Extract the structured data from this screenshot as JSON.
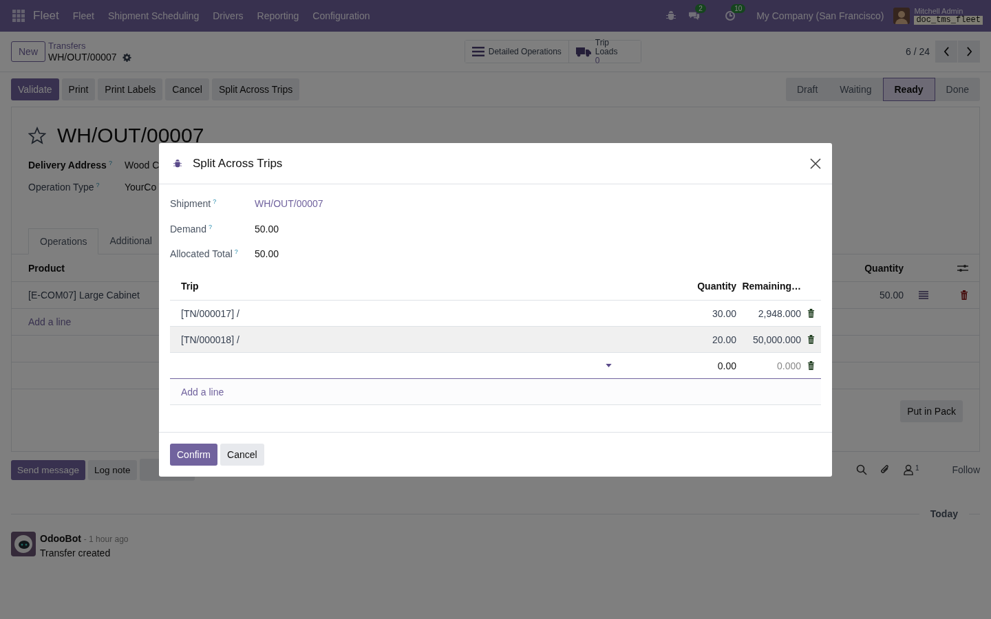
{
  "navbar": {
    "app_name": "Fleet",
    "menu": [
      "Fleet",
      "Shipment Scheduling",
      "Drivers",
      "Reporting",
      "Configuration"
    ],
    "messages_count": "2",
    "activities_count": "10",
    "company": "My Company (San Francisco)",
    "user_name": "Mitchell Admin",
    "database": "doc_tms_fleet"
  },
  "control_panel": {
    "new_button": "New",
    "breadcrumb": "Transfers",
    "record": "WH/OUT/00007",
    "smart_buttons": [
      {
        "kind": "list",
        "label": "Detailed Operations"
      },
      {
        "kind": "truck",
        "label": "Trip Loads",
        "value": "0"
      }
    ],
    "pager": "6 / 24"
  },
  "action_buttons": [
    {
      "label": "Validate",
      "primary": true
    },
    {
      "label": "Print",
      "primary": false
    },
    {
      "label": "Print Labels",
      "primary": false
    },
    {
      "label": "Cancel",
      "primary": false
    },
    {
      "label": "Split Across Trips",
      "primary": false
    }
  ],
  "statusbar": [
    {
      "label": "Draft",
      "selected": false
    },
    {
      "label": "Waiting",
      "selected": false
    },
    {
      "label": "Ready",
      "selected": true
    },
    {
      "label": "Done",
      "selected": false
    }
  ],
  "form": {
    "title": "WH/OUT/00007",
    "starred": false,
    "fields": [
      {
        "label": "Delivery Address",
        "help": "?",
        "value": "Wood C",
        "bold": true
      },
      {
        "label": "Operation Type",
        "help": "?",
        "value": "YourCo",
        "bold": false
      }
    ],
    "tabs": [
      {
        "label": "Operations",
        "selected": true
      },
      {
        "label": "Additional",
        "selected": false
      }
    ],
    "columns": [
      "Product",
      "Quantity"
    ],
    "rows": [
      {
        "product": "[E-COM07] Large Cabinet",
        "quantity": "50.00"
      }
    ],
    "add_line": "Add a line",
    "put_in_pack": "Put in Pack"
  },
  "chatter": {
    "buttons": [
      {
        "label": "Send message",
        "primary": true
      },
      {
        "label": "Log note",
        "primary": false
      },
      {
        "primary": false
      }
    ],
    "followers_count": "1",
    "follow": "Follow",
    "date_separator": "Today",
    "messages": [
      {
        "author": "OdooBot",
        "time": "- 1 hour ago",
        "body": "Transfer created"
      }
    ]
  },
  "dialog": {
    "title": "Split Across Trips",
    "fields": [
      {
        "label": "Shipment",
        "help": "?",
        "value": "WH/OUT/00007",
        "kind": "link"
      },
      {
        "label": "Demand",
        "help": "?",
        "value": "50.00",
        "kind": "text"
      },
      {
        "label": "Allocated Total",
        "help": "?",
        "value": "50.00",
        "kind": "text"
      }
    ],
    "columns": [
      "Trip",
      "Quantity",
      "Remaining…"
    ],
    "rows": [
      {
        "kind": "record",
        "trip": "[TN/000017] /",
        "quantity": "30.00",
        "remaining": "2,948.000",
        "selected": false
      },
      {
        "kind": "record",
        "trip": "[TN/000018] /",
        "quantity": "20.00",
        "remaining": "50,000.000",
        "selected": true
      },
      {
        "kind": "edit",
        "quantity": "0.00",
        "remaining": "0.000",
        "selected": false
      }
    ],
    "add_line": "Add a line",
    "buttons": [
      {
        "label": "Confirm",
        "primary": true
      },
      {
        "label": "Cancel",
        "primary": false
      }
    ]
  }
}
